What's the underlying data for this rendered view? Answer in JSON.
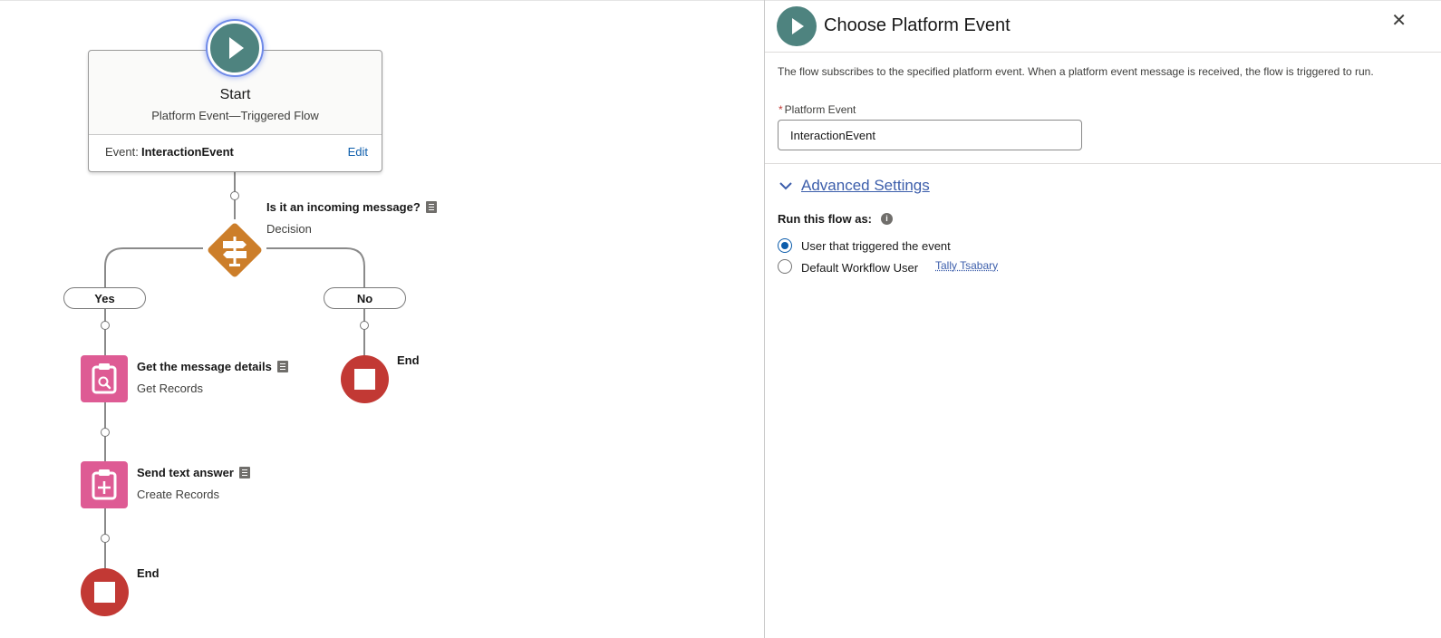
{
  "flow": {
    "start": {
      "title": "Start",
      "subtitle": "Platform Event—Triggered Flow",
      "event_label": "Event:",
      "event_value": "InteractionEvent",
      "edit_label": "Edit"
    },
    "decision": {
      "title": "Is it an incoming message?",
      "type": "Decision",
      "outcomes": [
        "Yes",
        "No"
      ]
    },
    "get_records": {
      "title": "Get the message details",
      "type": "Get Records"
    },
    "create_records": {
      "title": "Send text answer",
      "type": "Create Records"
    },
    "end_yes": "End",
    "end_no": "End",
    "colors": {
      "start": "#4e837f",
      "decision": "#cc7e2a",
      "record": "#de5b94",
      "end": "#c23934"
    }
  },
  "panel": {
    "title": "Choose Platform Event",
    "close_icon": "close-icon",
    "description": "The flow subscribes to the specified platform event. When a platform event message is received, the flow is triggered to run.",
    "field_label": "Platform Event",
    "field_value": "InteractionEvent",
    "advanced_label": "Advanced Settings",
    "run_as_label": "Run this flow as:",
    "options": [
      {
        "label": "User that triggered the event",
        "selected": true
      },
      {
        "label": "Default Workflow User",
        "selected": false,
        "user": "Tally Tsabary"
      }
    ]
  }
}
